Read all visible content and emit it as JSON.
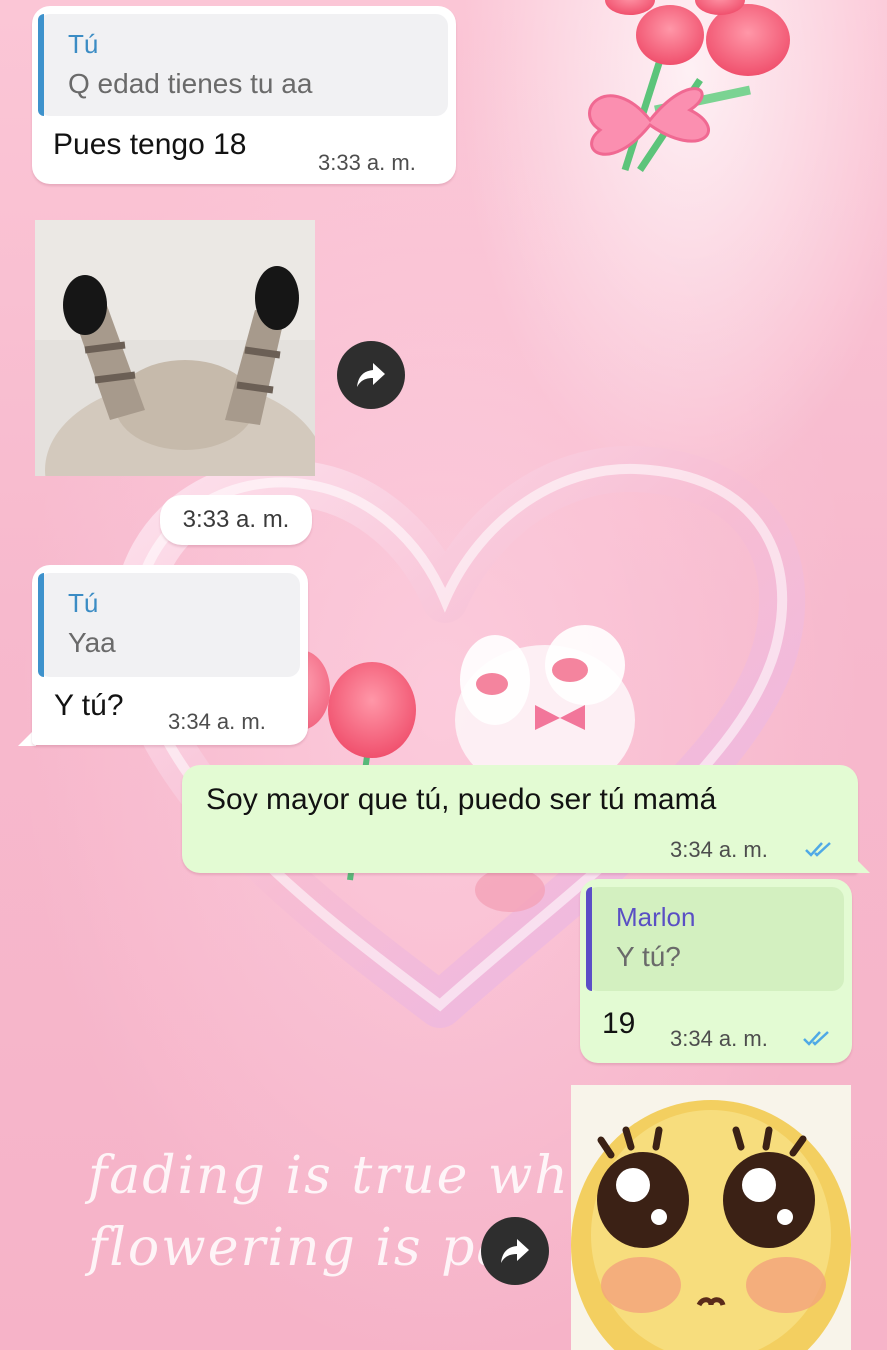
{
  "chat": {
    "msg1": {
      "quote_author": "Tú",
      "quote_text": "Q edad tienes tu aa",
      "text": "Pues tengo 18",
      "time": "3:33 a. m."
    },
    "sticker1": {
      "time": "3:33 a. m."
    },
    "msg2": {
      "quote_author": "Tú",
      "quote_text": "Yaa",
      "text": "Y tú?",
      "time": "3:34 a. m."
    },
    "msg3": {
      "text": "Soy mayor que tú, puedo ser tú mamá",
      "time": "3:34 a. m."
    },
    "msg4": {
      "quote_author": "Marlon",
      "quote_text": "Y tú?",
      "text": "19",
      "time": "3:34 a. m."
    }
  },
  "wallpaper": {
    "line1": "fading is true wh",
    "line2": "flowering is pa"
  },
  "icons": {
    "forward": "forward-arrow-icon",
    "read_receipt": "double-check-icon"
  },
  "colors": {
    "incoming_bubble": "#ffffff",
    "outgoing_bubble": "#e3fbd3",
    "read_ticks": "#4fa9e6",
    "background": "#f7b9cd"
  }
}
